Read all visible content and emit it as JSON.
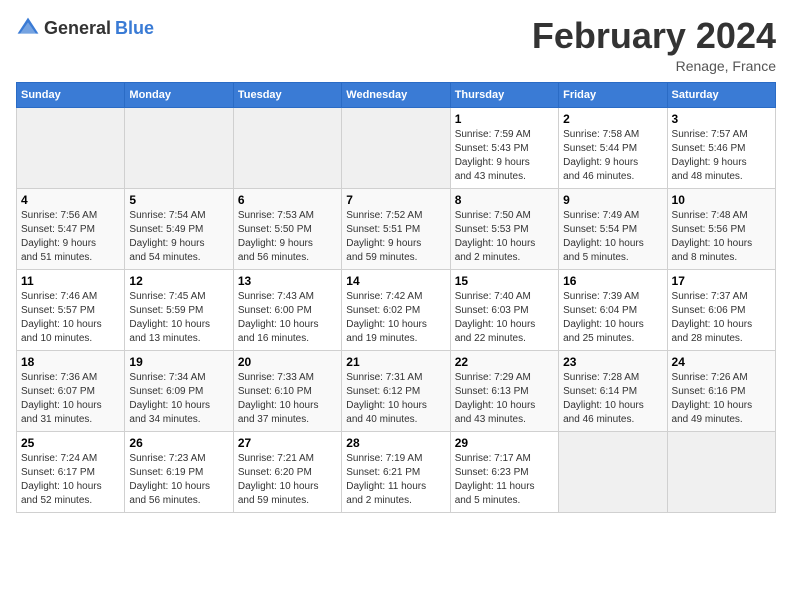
{
  "header": {
    "logo_general": "General",
    "logo_blue": "Blue",
    "title": "February 2024",
    "subtitle": "Renage, France"
  },
  "calendar": {
    "headers": [
      "Sunday",
      "Monday",
      "Tuesday",
      "Wednesday",
      "Thursday",
      "Friday",
      "Saturday"
    ],
    "weeks": [
      [
        {
          "day": "",
          "info": ""
        },
        {
          "day": "",
          "info": ""
        },
        {
          "day": "",
          "info": ""
        },
        {
          "day": "",
          "info": ""
        },
        {
          "day": "1",
          "info": "Sunrise: 7:59 AM\nSunset: 5:43 PM\nDaylight: 9 hours\nand 43 minutes."
        },
        {
          "day": "2",
          "info": "Sunrise: 7:58 AM\nSunset: 5:44 PM\nDaylight: 9 hours\nand 46 minutes."
        },
        {
          "day": "3",
          "info": "Sunrise: 7:57 AM\nSunset: 5:46 PM\nDaylight: 9 hours\nand 48 minutes."
        }
      ],
      [
        {
          "day": "4",
          "info": "Sunrise: 7:56 AM\nSunset: 5:47 PM\nDaylight: 9 hours\nand 51 minutes."
        },
        {
          "day": "5",
          "info": "Sunrise: 7:54 AM\nSunset: 5:49 PM\nDaylight: 9 hours\nand 54 minutes."
        },
        {
          "day": "6",
          "info": "Sunrise: 7:53 AM\nSunset: 5:50 PM\nDaylight: 9 hours\nand 56 minutes."
        },
        {
          "day": "7",
          "info": "Sunrise: 7:52 AM\nSunset: 5:51 PM\nDaylight: 9 hours\nand 59 minutes."
        },
        {
          "day": "8",
          "info": "Sunrise: 7:50 AM\nSunset: 5:53 PM\nDaylight: 10 hours\nand 2 minutes."
        },
        {
          "day": "9",
          "info": "Sunrise: 7:49 AM\nSunset: 5:54 PM\nDaylight: 10 hours\nand 5 minutes."
        },
        {
          "day": "10",
          "info": "Sunrise: 7:48 AM\nSunset: 5:56 PM\nDaylight: 10 hours\nand 8 minutes."
        }
      ],
      [
        {
          "day": "11",
          "info": "Sunrise: 7:46 AM\nSunset: 5:57 PM\nDaylight: 10 hours\nand 10 minutes."
        },
        {
          "day": "12",
          "info": "Sunrise: 7:45 AM\nSunset: 5:59 PM\nDaylight: 10 hours\nand 13 minutes."
        },
        {
          "day": "13",
          "info": "Sunrise: 7:43 AM\nSunset: 6:00 PM\nDaylight: 10 hours\nand 16 minutes."
        },
        {
          "day": "14",
          "info": "Sunrise: 7:42 AM\nSunset: 6:02 PM\nDaylight: 10 hours\nand 19 minutes."
        },
        {
          "day": "15",
          "info": "Sunrise: 7:40 AM\nSunset: 6:03 PM\nDaylight: 10 hours\nand 22 minutes."
        },
        {
          "day": "16",
          "info": "Sunrise: 7:39 AM\nSunset: 6:04 PM\nDaylight: 10 hours\nand 25 minutes."
        },
        {
          "day": "17",
          "info": "Sunrise: 7:37 AM\nSunset: 6:06 PM\nDaylight: 10 hours\nand 28 minutes."
        }
      ],
      [
        {
          "day": "18",
          "info": "Sunrise: 7:36 AM\nSunset: 6:07 PM\nDaylight: 10 hours\nand 31 minutes."
        },
        {
          "day": "19",
          "info": "Sunrise: 7:34 AM\nSunset: 6:09 PM\nDaylight: 10 hours\nand 34 minutes."
        },
        {
          "day": "20",
          "info": "Sunrise: 7:33 AM\nSunset: 6:10 PM\nDaylight: 10 hours\nand 37 minutes."
        },
        {
          "day": "21",
          "info": "Sunrise: 7:31 AM\nSunset: 6:12 PM\nDaylight: 10 hours\nand 40 minutes."
        },
        {
          "day": "22",
          "info": "Sunrise: 7:29 AM\nSunset: 6:13 PM\nDaylight: 10 hours\nand 43 minutes."
        },
        {
          "day": "23",
          "info": "Sunrise: 7:28 AM\nSunset: 6:14 PM\nDaylight: 10 hours\nand 46 minutes."
        },
        {
          "day": "24",
          "info": "Sunrise: 7:26 AM\nSunset: 6:16 PM\nDaylight: 10 hours\nand 49 minutes."
        }
      ],
      [
        {
          "day": "25",
          "info": "Sunrise: 7:24 AM\nSunset: 6:17 PM\nDaylight: 10 hours\nand 52 minutes."
        },
        {
          "day": "26",
          "info": "Sunrise: 7:23 AM\nSunset: 6:19 PM\nDaylight: 10 hours\nand 56 minutes."
        },
        {
          "day": "27",
          "info": "Sunrise: 7:21 AM\nSunset: 6:20 PM\nDaylight: 10 hours\nand 59 minutes."
        },
        {
          "day": "28",
          "info": "Sunrise: 7:19 AM\nSunset: 6:21 PM\nDaylight: 11 hours\nand 2 minutes."
        },
        {
          "day": "29",
          "info": "Sunrise: 7:17 AM\nSunset: 6:23 PM\nDaylight: 11 hours\nand 5 minutes."
        },
        {
          "day": "",
          "info": ""
        },
        {
          "day": "",
          "info": ""
        }
      ]
    ]
  }
}
